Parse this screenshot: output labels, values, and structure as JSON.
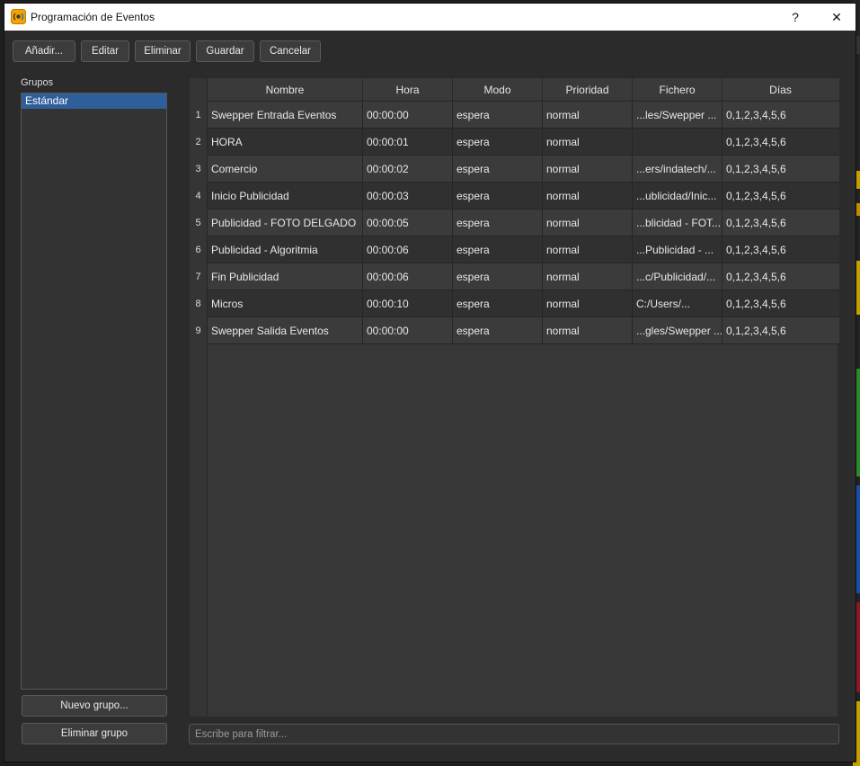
{
  "window": {
    "title": "Programación de Eventos",
    "help_label": "?",
    "close_label": "✕"
  },
  "toolbar": {
    "add": "Añadir...",
    "edit": "Editar",
    "delete": "Eliminar",
    "save": "Guardar",
    "cancel": "Cancelar"
  },
  "groups": {
    "label": "Grupos",
    "items": [
      "Estándar"
    ],
    "new_group": "Nuevo grupo...",
    "delete_group": "Eliminar grupo"
  },
  "table": {
    "columns": [
      "Nombre",
      "Hora",
      "Modo",
      "Prioridad",
      "Fichero",
      "Días"
    ],
    "rows": [
      {
        "num": "1",
        "nombre": "Swepper Entrada Eventos",
        "hora": "00:00:00",
        "modo": "espera",
        "prioridad": "normal",
        "fichero": "...les/Swepper ...",
        "dias": "0,1,2,3,4,5,6"
      },
      {
        "num": "2",
        "nombre": "HORA",
        "hora": "00:00:01",
        "modo": "espera",
        "prioridad": "normal",
        "fichero": "",
        "dias": "0,1,2,3,4,5,6"
      },
      {
        "num": "3",
        "nombre": "Comercio",
        "hora": "00:00:02",
        "modo": "espera",
        "prioridad": "normal",
        "fichero": "...ers/indatech/...",
        "dias": "0,1,2,3,4,5,6"
      },
      {
        "num": "4",
        "nombre": "Inicio Publicidad",
        "hora": "00:00:03",
        "modo": "espera",
        "prioridad": "normal",
        "fichero": "...ublicidad/Inic...",
        "dias": "0,1,2,3,4,5,6"
      },
      {
        "num": "5",
        "nombre": "Publicidad - FOTO DELGADO",
        "hora": "00:00:05",
        "modo": "espera",
        "prioridad": "normal",
        "fichero": "...blicidad - FOT...",
        "dias": "0,1,2,3,4,5,6"
      },
      {
        "num": "6",
        "nombre": "Publicidad - Algoritmia",
        "hora": "00:00:06",
        "modo": "espera",
        "prioridad": "normal",
        "fichero": "...Publicidad - ...",
        "dias": "0,1,2,3,4,5,6"
      },
      {
        "num": "7",
        "nombre": "Fin Publicidad",
        "hora": "00:00:06",
        "modo": "espera",
        "prioridad": "normal",
        "fichero": "...c/Publicidad/...",
        "dias": "0,1,2,3,4,5,6"
      },
      {
        "num": "8",
        "nombre": "Micros",
        "hora": "00:00:10",
        "modo": "espera",
        "prioridad": "normal",
        "fichero": "C:/Users/...",
        "dias": "0,1,2,3,4,5,6"
      },
      {
        "num": "9",
        "nombre": "Swepper Salida Eventos",
        "hora": "00:00:00",
        "modo": "espera",
        "prioridad": "normal",
        "fichero": "...gles/Swepper ...",
        "dias": "0,1,2,3,4,5,6"
      }
    ]
  },
  "filter": {
    "placeholder": "Escribe para filtrar..."
  },
  "colors": {
    "selection": "#2f5f9a",
    "dialog_bg": "#2b2b2b",
    "titlebar_bg": "#ffffff"
  },
  "icons": {
    "app": "broadcast-app-icon",
    "help": "help-icon",
    "close": "close-icon"
  }
}
